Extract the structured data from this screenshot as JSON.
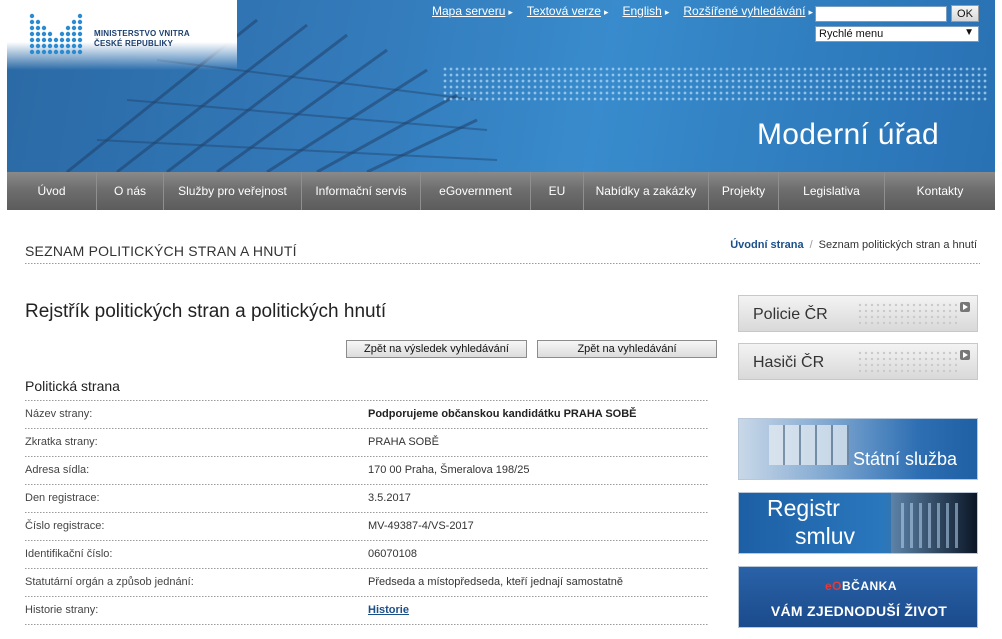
{
  "header": {
    "logo_line1": "MINISTERSTVO VNITRA",
    "logo_line2": "ČESKÉ REPUBLIKY",
    "tagline": "Moderní úřad",
    "top_links": [
      "Mapa serveru",
      "Textová verze",
      "English",
      "Rozšířené vyhledávání"
    ],
    "search_button": "OK",
    "quick_menu": "Rychlé menu"
  },
  "nav": {
    "items": [
      "Úvod",
      "O nás",
      "Služby pro veřejnost",
      "Informační servis",
      "eGovernment",
      "EU",
      "Nabídky a zakázky",
      "Projekty",
      "Legislativa",
      "Kontakty"
    ]
  },
  "page": {
    "title": "SEZNAM POLITICKÝCH STRAN A HNUTÍ",
    "breadcrumb_home": "Úvodní strana",
    "breadcrumb_sep": "/",
    "breadcrumb_current": "Seznam politických stran a hnutí"
  },
  "main": {
    "heading": "Rejstřík politických stran a politických hnutí",
    "btn_back_results": "Zpět na výsledek vyhledávání",
    "btn_back_search": "Zpět na vyhledávání",
    "section_title": "Politická strana",
    "rows": [
      {
        "label": "Název strany:",
        "value": "Podporujeme občanskou kandidátku PRAHA SOBĚ"
      },
      {
        "label": "Zkratka strany:",
        "value": "PRAHA SOBĚ"
      },
      {
        "label": "Adresa sídla:",
        "value": "170 00 Praha, Šmeralova 198/25"
      },
      {
        "label": "Den registrace:",
        "value": "3.5.2017"
      },
      {
        "label": "Číslo registrace:",
        "value": "MV-49387-4/VS-2017"
      },
      {
        "label": "Identifikační číslo:",
        "value": "06070108"
      },
      {
        "label": "Statutární orgán a způsob jednání:",
        "value": "Předseda a místopředseda, kteří jednají samostatně"
      },
      {
        "label": "Historie strany:",
        "value": "Historie"
      }
    ]
  },
  "sidebar": {
    "policie": "Policie ČR",
    "hasici": "Hasiči ČR",
    "statni_sluzba": "Státní služba",
    "registr_line1": "Registr",
    "registr_line2": "smluv",
    "obcanka_brand_prefix": "eO",
    "obcanka_brand_rest": "BČANKA",
    "obcanka_slogan": "VÁM ZJEDNODUŠÍ ŽIVOT"
  }
}
